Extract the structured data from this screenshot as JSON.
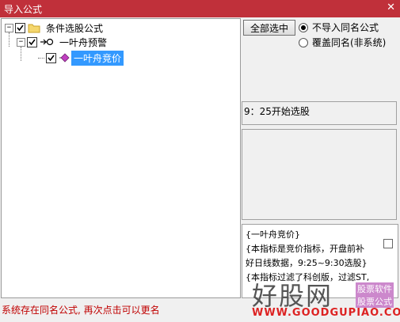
{
  "window": {
    "title": "导入公式",
    "close_glyph": "✕"
  },
  "tree": {
    "root": {
      "label": "条件选股公式",
      "expander": "−",
      "checked": true
    },
    "child": {
      "label": "一叶舟预警",
      "expander": "−",
      "checked": true
    },
    "leaf": {
      "label": "一叶舟竞价",
      "checked": true,
      "selected": true
    }
  },
  "controls": {
    "select_all_label": "全部选中",
    "radio_skip_label": "不导入同名公式",
    "radio_overwrite_label": "覆盖同名(非系统)",
    "selected_radio": "skip"
  },
  "panels": {
    "time_note": "9：25开始选股",
    "description_lines": [
      "{一叶舟竞价}",
      "{本指标是竞价指标，开盘前补",
      "好日线数据，9:25~9:30选股}",
      "{本指标过滤了科创版，过滤ST,"
    ]
  },
  "status_text": "系统存在同名公式, 再次点击可以更名",
  "watermark": {
    "brand": "好股网",
    "url": "WWW.GOODGUPIAO.COM",
    "tag1": "股票软件",
    "tag2": "股票公式"
  },
  "colors": {
    "titlebar": "#c0303a",
    "selection": "#3399ff",
    "status": "#c00000"
  },
  "icons": [
    "folder-icon",
    "formula-link-icon",
    "formula-diamond-icon",
    "checkbox-checked-icon",
    "close-icon"
  ]
}
